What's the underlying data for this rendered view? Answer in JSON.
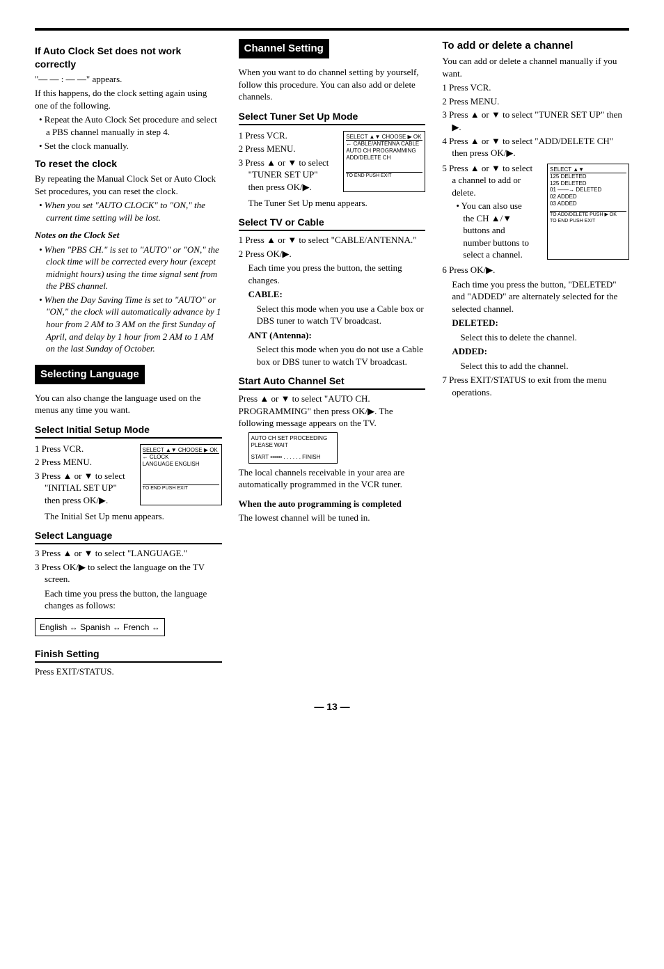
{
  "page_number": "— 13 —",
  "col1": {
    "h1": "If Auto Clock Set does not work correctly",
    "p1": "\"— — : — —\" appears.",
    "p2": "If this happens, do the clock setting again using one of the following.",
    "b1": "• Repeat the Auto Clock Set procedure and select a PBS channel manually in step 4.",
    "b2": "• Set the clock manually.",
    "h2": "To reset the clock",
    "p3": "By repeating the Manual Clock Set or Auto Clock Set procedures, you can reset the clock.",
    "n1": "• When you set \"AUTO CLOCK\" to \"ON,\" the current time setting will be lost.",
    "h3": "Notes on the Clock Set",
    "n2": "• When \"PBS CH.\" is set to \"AUTO\" or \"ON,\" the clock time will be corrected every hour (except midnight hours) using the time signal sent from the PBS channel.",
    "n3": "• When the Day Saving Time is set to \"AUTO\" or \"ON,\" the clock will automatically advance by 1 hour from 2 AM to 3 AM on the first Sunday of April, and delay by 1 hour from 2 AM to 1 AM on the last Sunday of October.",
    "bar1": "Selecting Language",
    "p4": "You can also change the language used on the menus any time you want.",
    "sub1": "Select Initial Setup Mode",
    "s1": "1 Press VCR.",
    "s2": "2 Press MENU.",
    "s3": "3 Press ▲ or ▼ to select \"INITIAL SET UP\" then press OK/▶.",
    "s3b": "The Initial Set Up menu appears.",
    "osd1_header": "SELECT ▲▼ CHOOSE ▶ OK",
    "osd1_line1": "← CLOCK",
    "osd1_line2": "   LANGUAGE        ENGLISH",
    "osd1_footer": "TO END PUSH EXIT",
    "sub2": "Select Language",
    "s4": "3 Press ▲ or ▼ to select \"LANGUAGE.\"",
    "s5": "3 Press OK/▶ to select the language on the TV screen.",
    "s5b": "Each time you press the button, the language changes as follows:",
    "cycle": "English ↔ Spanish ↔ French ↔",
    "sub3": "Finish Setting",
    "s6": "Press EXIT/STATUS."
  },
  "col2": {
    "bar1": "Channel Setting",
    "p1": "When you want to do channel setting by yourself, follow this procedure. You can also add or delete channels.",
    "sub1": "Select Tuner Set Up Mode",
    "s1": "1 Press VCR.",
    "s2": "2 Press MENU.",
    "s3": "3 Press ▲ or ▼ to select \"TUNER SET UP\" then press OK/▶.",
    "s3b": "The Tuner Set Up menu appears.",
    "osd1_header": "SELECT ▲▼ CHOOSE ▶ OK",
    "osd1_line1": "← CABLE/ANTENNA   CABLE",
    "osd1_line2": "   AUTO CH PROGRAMMING",
    "osd1_line3": "   ADD/DELETE CH",
    "osd1_footer": "TO END PUSH EXIT",
    "sub2": "Select TV or Cable",
    "s4": "1 Press ▲ or ▼ to select \"CABLE/ANTENNA.\"",
    "s5": "2 Press OK/▶.",
    "s5b": "Each time you press the button, the setting changes.",
    "h_cable": "CABLE:",
    "p_cable": "Select this mode when you use a Cable box or DBS tuner to watch TV broadcast.",
    "h_ant": "ANT (Antenna):",
    "p_ant": "Select this mode when you do not use a Cable box or DBS tuner to watch TV broadcast.",
    "sub3": "Start Auto Channel Set",
    "p2": "Press ▲ or ▼ to select \"AUTO CH. PROGRAMMING\" then press OK/▶. The following message appears on the TV.",
    "osd2_l1": "AUTO CH SET PROCEEDING",
    "osd2_l2": "PLEASE WAIT",
    "osd2_l3": "START ▪▪▪▪▪▪ . . . . . . FINISH",
    "p3": "The local channels receivable in your area are automatically programmed in the VCR tuner.",
    "h4": "When the auto programming is completed",
    "p4": "The lowest channel will be tuned in."
  },
  "col3": {
    "h1": "To add or delete a channel",
    "p1": "You can add or delete a channel manually if you want.",
    "s1": "1 Press VCR.",
    "s2": "2 Press MENU.",
    "s3": "3 Press ▲ or ▼ to select \"TUNER SET UP\" then ▶.",
    "s4": "4 Press ▲ or ▼ to select \"ADD/DELETE CH\" then press OK/▶.",
    "s5": "5 Press ▲ or ▼ to select a channel to add or delete.",
    "s5n": "• You can also use the CH ▲/▼ buttons and number buttons to select a channel.",
    "osd_header": "SELECT ▲▼",
    "osd_l1": "125        DELETED",
    "osd_l2": "125        DELETED",
    "osd_l3": "01 ——→ DELETED",
    "osd_l4": "02         ADDED",
    "osd_l5": "03         ADDED",
    "osd_footer": "TO ADD/DELETE PUSH ▶ OK\nTO END PUSH EXIT",
    "s6": "6 Press OK/▶.",
    "s6b": "Each time you press the button, \"DELETED\" and \"ADDED\" are alternately selected for the selected channel.",
    "h_del": "DELETED:",
    "p_del": "Select this to delete the channel.",
    "h_add": "ADDED:",
    "p_add": "Select this to add the channel.",
    "s7": "7 Press EXIT/STATUS to exit from the menu operations."
  }
}
